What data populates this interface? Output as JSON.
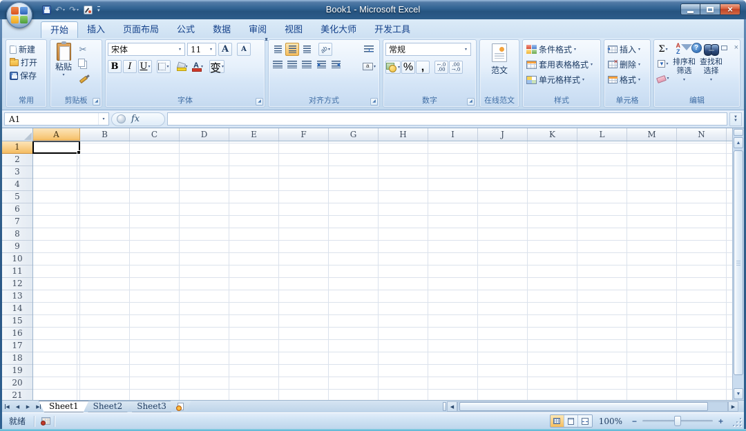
{
  "window": {
    "title": "Book1 - Microsoft Excel"
  },
  "icons": {
    "undo": "↶",
    "redo": "↷",
    "dropdown": "▾",
    "help": "?",
    "close": "×",
    "up_arrow": "▲",
    "down_arrow": "▼",
    "left_arrow": "◀",
    "right_arrow": "▶",
    "scissors": "✂",
    "launcher": "◢",
    "expand_chevron": "▼▼",
    "zoom_out": "−",
    "zoom_in": "+",
    "fill_down": "▼"
  },
  "ribbon_tabs": [
    {
      "label": "开始",
      "active": true
    },
    {
      "label": "插入"
    },
    {
      "label": "页面布局"
    },
    {
      "label": "公式"
    },
    {
      "label": "数据"
    },
    {
      "label": "审阅"
    },
    {
      "label": "视图"
    },
    {
      "label": "美化大师"
    },
    {
      "label": "开发工具"
    }
  ],
  "ribbon": {
    "common": {
      "label": "常用",
      "new": "新建",
      "open": "打开",
      "save": "保存"
    },
    "clipboard": {
      "label": "剪贴板",
      "paste": "粘贴"
    },
    "font": {
      "label": "字体",
      "name": "宋体",
      "size": "11",
      "grow": "A",
      "shrink": "A",
      "bold": "B",
      "italic": "I",
      "underline": "U",
      "color_a": "A",
      "phonetic": "变"
    },
    "alignment": {
      "label": "对齐方式",
      "orient": "ab"
    },
    "number": {
      "label": "数字",
      "format": "常规",
      "percent": "%",
      "comma": ",",
      "inc_decimal": "←.0\n.00",
      "dec_decimal": ".00\n→.0"
    },
    "online": {
      "label": "在线范文",
      "button": "范文"
    },
    "styles": {
      "label": "样式",
      "items": [
        {
          "label": "条件格式"
        },
        {
          "label": "套用表格格式"
        },
        {
          "label": "单元格样式"
        }
      ]
    },
    "cells": {
      "label": "单元格",
      "items": [
        {
          "label": "插入"
        },
        {
          "label": "删除"
        },
        {
          "label": "格式"
        }
      ]
    },
    "editing": {
      "label": "编辑",
      "sum": "Σ",
      "sort_a": "A",
      "sort_z": "Z",
      "sort": "排序和\n筛选",
      "find": "查找和\n选择"
    }
  },
  "formula_bar": {
    "name_box": "A1",
    "fx": "fx"
  },
  "grid": {
    "selected_cell": "A1",
    "columns": [
      {
        "label": "A",
        "active": true
      },
      {
        "label": "B"
      },
      {
        "label": "C"
      },
      {
        "label": "D"
      },
      {
        "label": "E"
      },
      {
        "label": "F"
      },
      {
        "label": "G"
      },
      {
        "label": "H"
      },
      {
        "label": "I"
      },
      {
        "label": "J"
      },
      {
        "label": "K"
      },
      {
        "label": "L"
      },
      {
        "label": "M"
      },
      {
        "label": "N"
      }
    ],
    "rows": [
      {
        "label": "1",
        "active": true
      },
      {
        "label": "2"
      },
      {
        "label": "3"
      },
      {
        "label": "4"
      },
      {
        "label": "5"
      },
      {
        "label": "6"
      },
      {
        "label": "7"
      },
      {
        "label": "8"
      },
      {
        "label": "9"
      },
      {
        "label": "10"
      },
      {
        "label": "11"
      },
      {
        "label": "12"
      },
      {
        "label": "13"
      },
      {
        "label": "14"
      },
      {
        "label": "15"
      },
      {
        "label": "16"
      },
      {
        "label": "17"
      },
      {
        "label": "18"
      },
      {
        "label": "19"
      },
      {
        "label": "20"
      },
      {
        "label": "21"
      }
    ]
  },
  "sheet_tabs": [
    {
      "label": "Sheet1",
      "active": true
    },
    {
      "label": "Sheet2"
    },
    {
      "label": "Sheet3"
    }
  ],
  "status_bar": {
    "ready": "就绪",
    "zoom_level": "100%"
  }
}
